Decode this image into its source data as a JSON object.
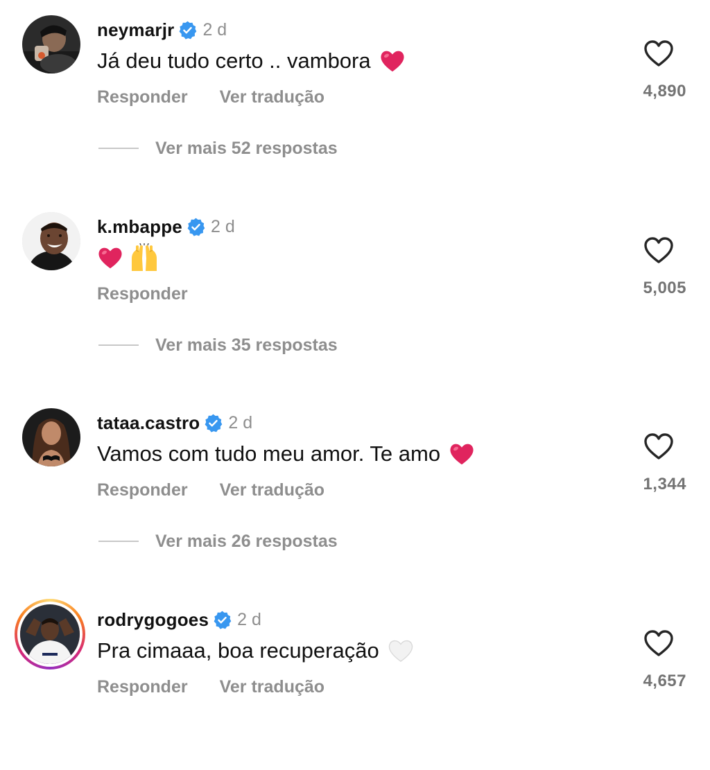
{
  "colors": {
    "verified_badge": "#3897f0",
    "secondary_text": "#8e8e8e",
    "heart_emoji": "#e0245e",
    "white_heart_emoji": "#eeeeee"
  },
  "comments": [
    {
      "username": "neymarjr",
      "verified": true,
      "time": "2 d",
      "text": "Já deu tudo certo .. vambora",
      "emojis": [
        "red-heart"
      ],
      "actions": {
        "reply": "Responder",
        "translate": "Ver tradução"
      },
      "likes": "4,890",
      "replies_label": "Ver mais 52 respostas"
    },
    {
      "username": "k.mbappe",
      "verified": true,
      "time": "2 d",
      "text": "",
      "emojis": [
        "red-heart",
        "raising-hands"
      ],
      "actions": {
        "reply": "Responder"
      },
      "likes": "5,005",
      "replies_label": "Ver mais 35 respostas"
    },
    {
      "username": "tataa.castro",
      "verified": true,
      "time": "2 d",
      "text": "Vamos com tudo meu amor. Te amo",
      "emojis": [
        "red-heart"
      ],
      "actions": {
        "reply": "Responder",
        "translate": "Ver tradução"
      },
      "likes": "1,344",
      "replies_label": "Ver mais 26 respostas"
    },
    {
      "username": "rodrygogoes",
      "verified": true,
      "time": "2 d",
      "text": "Pra cimaaa, boa recuperação",
      "emojis": [
        "white-heart"
      ],
      "actions": {
        "reply": "Responder",
        "translate": "Ver tradução"
      },
      "likes": "4,657",
      "has_story_ring": true
    }
  ]
}
